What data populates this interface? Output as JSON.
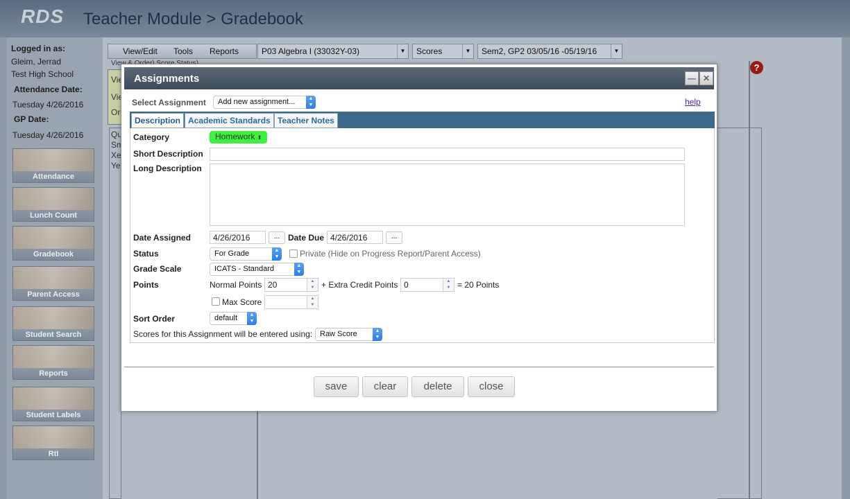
{
  "header": {
    "logo": "RDS",
    "title": "Teacher Module > Gradebook"
  },
  "sidebar": {
    "logged_in_label": "Logged in as:",
    "user_name": "Gleim, Jerrad",
    "school": "Test High School",
    "attendance_date_label": "Attendance Date:",
    "attendance_date": "Tuesday 4/26/2016",
    "gp_date_label": "GP Date:",
    "gp_date": "Tuesday 4/26/2016",
    "nav": [
      {
        "label": "Attendance"
      },
      {
        "label": "Lunch Count"
      },
      {
        "label": "Gradebook"
      },
      {
        "label": "Parent Access"
      },
      {
        "label": "Student Search"
      },
      {
        "label": "Reports"
      },
      {
        "label": "Student Labels"
      },
      {
        "label": "RtI"
      }
    ]
  },
  "toolbar": {
    "menu": [
      "View/Edit",
      "Tools",
      "Reports"
    ],
    "class_select": "P03  Algebra I (33032Y-03)",
    "view_select": "Scores",
    "period_select": "Sem2, GP2  03/05/16  -05/19/16"
  },
  "background": {
    "subheader": "View & Order)  Score Status)",
    "side_items": [
      "Vie",
      "Vie",
      "Ord"
    ],
    "list_items": [
      "Qu",
      "Sm",
      "Xe",
      "Ye"
    ],
    "help_icon": "?"
  },
  "modal": {
    "title": "Assignments",
    "select_assignment_label": "Select Assignment",
    "select_assignment_value": "Add new assignment...",
    "help_link": "help",
    "tabs": [
      "Description",
      "Academic Standards",
      "Teacher Notes"
    ],
    "category_label": "Category",
    "category_value": "Homework",
    "category_color": "#3cf23c",
    "short_desc_label": "Short Description",
    "short_desc_value": "",
    "long_desc_label": "Long Description",
    "long_desc_value": "",
    "date_assigned_label": "Date Assigned",
    "date_assigned_value": "4/26/2016",
    "date_due_label": "Date Due",
    "date_due_value": "4/26/2016",
    "date_button": "...",
    "status_label": "Status",
    "status_value": "For Grade",
    "private_label": "Private (Hide on Progress Report/Parent Access)",
    "grade_scale_label": "Grade Scale",
    "grade_scale_value": "ICATS - Standard",
    "points_label": "Points",
    "normal_points_label": "Normal Points",
    "normal_points_value": "20",
    "extra_credit_label": "+ Extra Credit Points",
    "extra_credit_value": "0",
    "total_points": "= 20 Points",
    "max_score_label": "Max Score",
    "max_score_value": "",
    "sort_order_label": "Sort Order",
    "sort_order_value": "default",
    "entry_label": "Scores for this Assignment will be entered using:",
    "entry_value": "Raw Score",
    "buttons": {
      "save": "save",
      "clear": "clear",
      "delete": "delete",
      "close": "close"
    },
    "minimize_glyph": "—",
    "close_glyph": "✕"
  }
}
